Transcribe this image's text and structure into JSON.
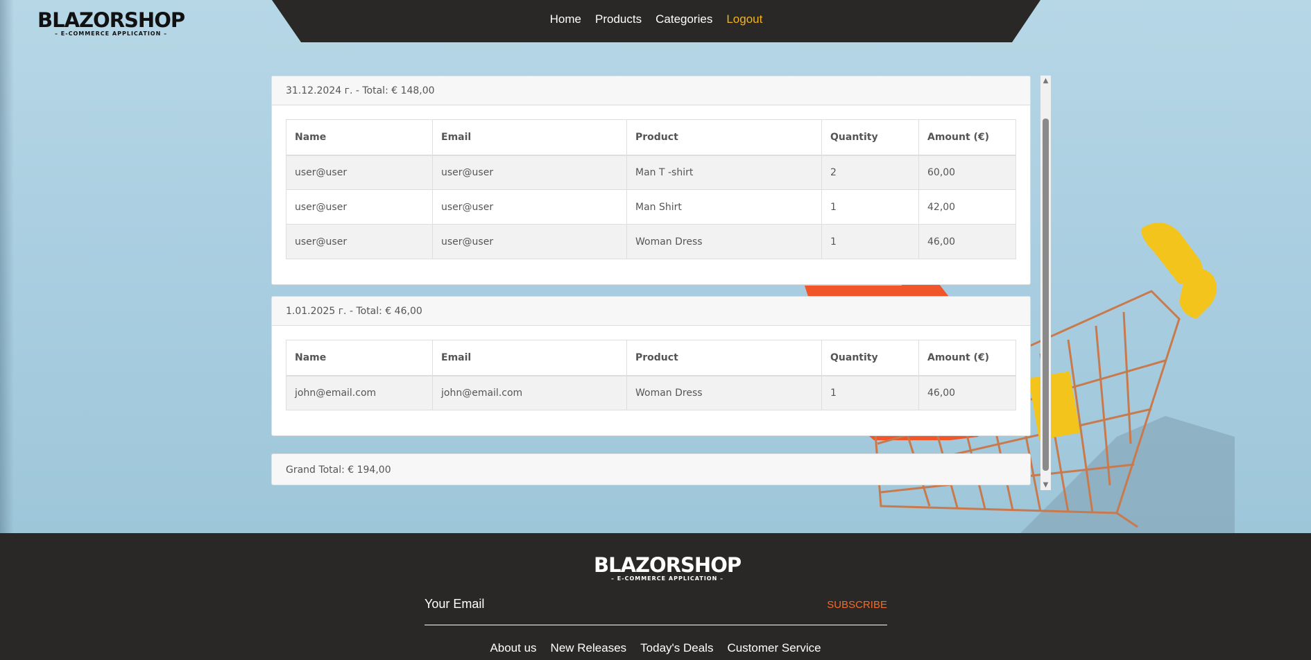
{
  "brand": {
    "name": "BLAZORSHOP",
    "tagline": "– E-COMMERCE APPLICATION –"
  },
  "nav": {
    "items": [
      {
        "label": "Home"
      },
      {
        "label": "Products"
      },
      {
        "label": "Categories"
      },
      {
        "label": "Logout"
      }
    ]
  },
  "orders": [
    {
      "header": "31.12.2024 г. - Total: € 148,00",
      "columns": [
        "Name",
        "Email",
        "Product",
        "Quantity",
        "Amount (€)"
      ],
      "rows": [
        [
          "user@user",
          "user@user",
          "Man T -shirt",
          "2",
          "60,00"
        ],
        [
          "user@user",
          "user@user",
          "Man Shirt",
          "1",
          "42,00"
        ],
        [
          "user@user",
          "user@user",
          "Woman Dress",
          "1",
          "46,00"
        ]
      ]
    },
    {
      "header": "1.01.2025 г. - Total: € 46,00",
      "columns": [
        "Name",
        "Email",
        "Product",
        "Quantity",
        "Amount (€)"
      ],
      "rows": [
        [
          "john@email.com",
          "john@email.com",
          "Woman Dress",
          "1",
          "46,00"
        ]
      ]
    }
  ],
  "grand_total": "Grand Total: € 194,00",
  "footer": {
    "email_placeholder": "Your Email",
    "subscribe_label": "SUBSCRIBE",
    "links": [
      {
        "label": "About us"
      },
      {
        "label": "New Releases"
      },
      {
        "label": "Today's Deals"
      },
      {
        "label": "Customer Service"
      }
    ]
  },
  "colors": {
    "nav_bg": "#2a2826",
    "active_link": "#f2b41a",
    "subscribe": "#f26b2a"
  }
}
